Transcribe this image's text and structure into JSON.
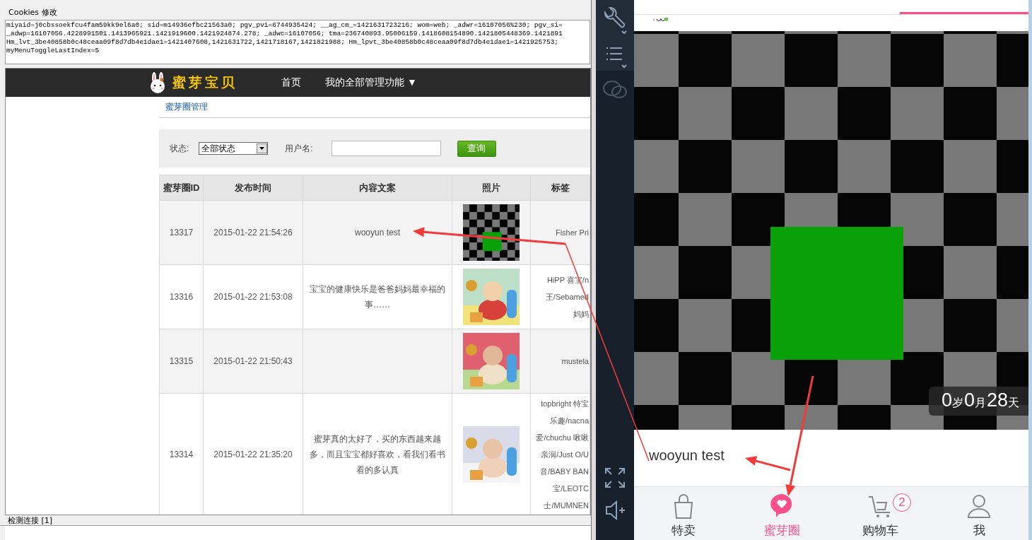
{
  "cookie_editor": {
    "title": "Cookies 修改",
    "lines": [
      "miyaid=j0cbssoekfcu4fam59kk9el6a0; sid=m14936efbc21563a0; pgv_pvi=6744935424; __ag_cm_=1421631723216; wom=web; _adwr=16107056%230; pgv_si=",
      "_adwp=16107056.4228991501.1413965921.1421919600.1421924874.278; _adwc=16107056; tma=236740893.95006159.1418608154890.1421805448369.1421891",
      "Hm_lvt_3be40858b0c48ceaa09f8d7db4e1dae1=1421407608,1421631722,1421718167,1421821988; Hm_lpvt_3be40858b0c48ceaa09f8d7db4e1dae1=1421925753;",
      "myMenuToggleLastIndex=5"
    ]
  },
  "site": {
    "logo": "蜜芽宝贝",
    "nav": [
      "首页",
      "我的全部管理功能 ▼"
    ],
    "breadcrumb": "蜜芽圈管理",
    "filter": {
      "status_label": "状态:",
      "status_value": "全部状态",
      "username_label": "用户名:",
      "button": "查询"
    },
    "table": {
      "columns": [
        "蜜芽圈ID",
        "发布时间",
        "内容文案",
        "照片",
        "标签"
      ],
      "rows": [
        {
          "id": "13317",
          "time": "2015-01-22 21:54:26",
          "content": "wooyun test",
          "photo": {
            "kind": "checker"
          },
          "tags": [
            "Fisher Pri"
          ]
        },
        {
          "id": "13316",
          "time": "2015-01-22 21:53:08",
          "content": "宝宝的健康快乐是爸爸妈妈最幸福的事……",
          "photo": {
            "kind": "picture"
          },
          "tags": [
            "HiPP 喜宝/n",
            "王/Sebamed",
            "妈妈"
          ]
        },
        {
          "id": "13315",
          "time": "2015-01-22 21:50:43",
          "content": "",
          "photo": {
            "kind": "picture"
          },
          "tags": [
            "mustela"
          ]
        },
        {
          "id": "13314",
          "time": "2015-01-22 21:35:20",
          "content": "蜜芽真的太好了，买的东西越来越多，而且宝宝都好喜欢，看我们看书看的多认真",
          "photo": {
            "kind": "picture"
          },
          "tags": [
            "topbright 特宝",
            "乐趣/nacna",
            "爱/chuchu 啾啾",
            "亲润/Just O/U",
            "音/BABY BAN",
            "宝/LEOTC",
            "士/MUMNEN"
          ]
        }
      ]
    }
  },
  "status_bar": "检测连接 [1]",
  "app": {
    "post": {
      "photo": {
        "kind": "checker"
      },
      "age": [
        {
          "value": "0",
          "unit": "岁"
        },
        {
          "value": "0",
          "unit": "月"
        },
        {
          "value": "28",
          "unit": "天"
        }
      ],
      "caption": "wooyun test"
    },
    "tabs": [
      {
        "label": "特卖",
        "selected": false
      },
      {
        "label": "蜜芽圈",
        "selected": true
      },
      {
        "label": "购物车",
        "selected": false,
        "badge": "2"
      },
      {
        "label": "我",
        "selected": false
      }
    ]
  }
}
